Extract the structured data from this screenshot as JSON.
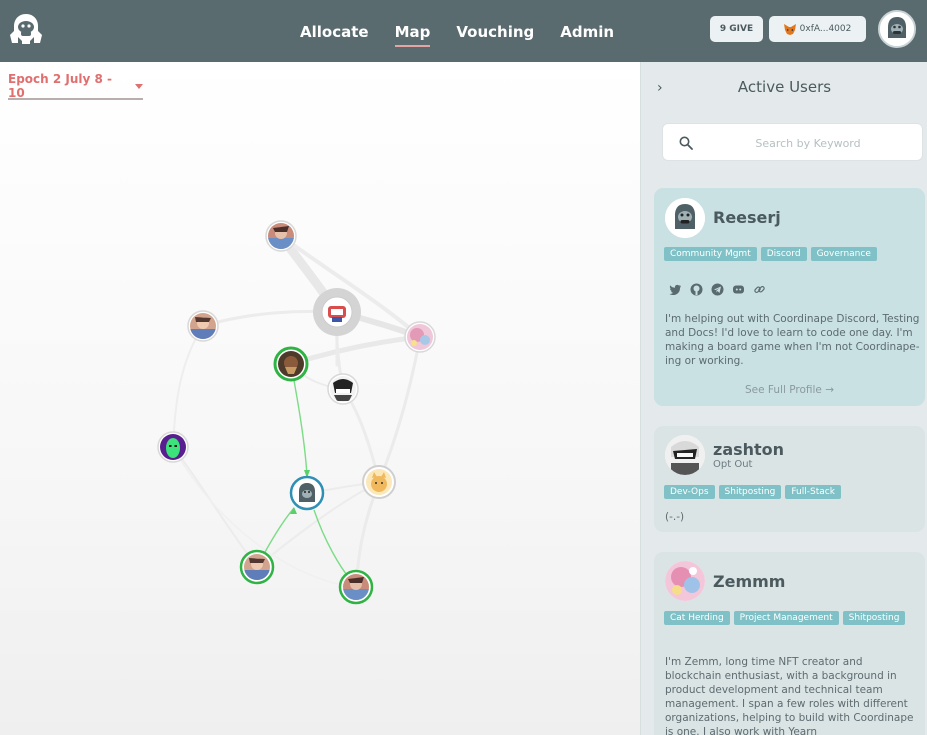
{
  "header": {
    "nav": [
      {
        "label": "Allocate"
      },
      {
        "label": "Map"
      },
      {
        "label": "Vouching"
      },
      {
        "label": "Admin"
      }
    ],
    "give_badge": "9 GIVE",
    "wallet": "0xfA...4002"
  },
  "map": {
    "epoch_label": "Epoch 2 July 8 - 10"
  },
  "sidebar": {
    "title": "Active Users",
    "search_placeholder": "Search by Keyword",
    "users": [
      {
        "name": "Reeserj",
        "tags": [
          "Community Mgmt",
          "Discord",
          "Governance"
        ],
        "bio": "I'm helping out with Coordinape Discord, Testing and Docs! I'd love to learn to code one day. I'm making a board game when I'm not Coordinape-ing or working.",
        "profile_link": "See Full Profile →"
      },
      {
        "name": "zashton",
        "status": "Opt Out",
        "tags": [
          "Dev-Ops",
          "Shitposting",
          "Full-Stack"
        ],
        "bio": "(-.-)"
      },
      {
        "name": "Zemmm",
        "tags": [
          "Cat Herding",
          "Project Management",
          "Shitposting"
        ],
        "bio": "I'm Zemm, long time NFT creator and blockchain enthusiast, with a background in product development and technical team management. I span a few roles with different organizations, helping to build with Coordinape is one. I also work with Yearn"
      }
    ]
  },
  "colors": {
    "header_bg": "#5a6b70",
    "accent_red": "#e06f6f",
    "tag_bg": "#7fc1c6",
    "give_edge": "#59d06a",
    "node_ring_green": "#2fb344",
    "node_ring_blue": "#2f8fb5"
  }
}
